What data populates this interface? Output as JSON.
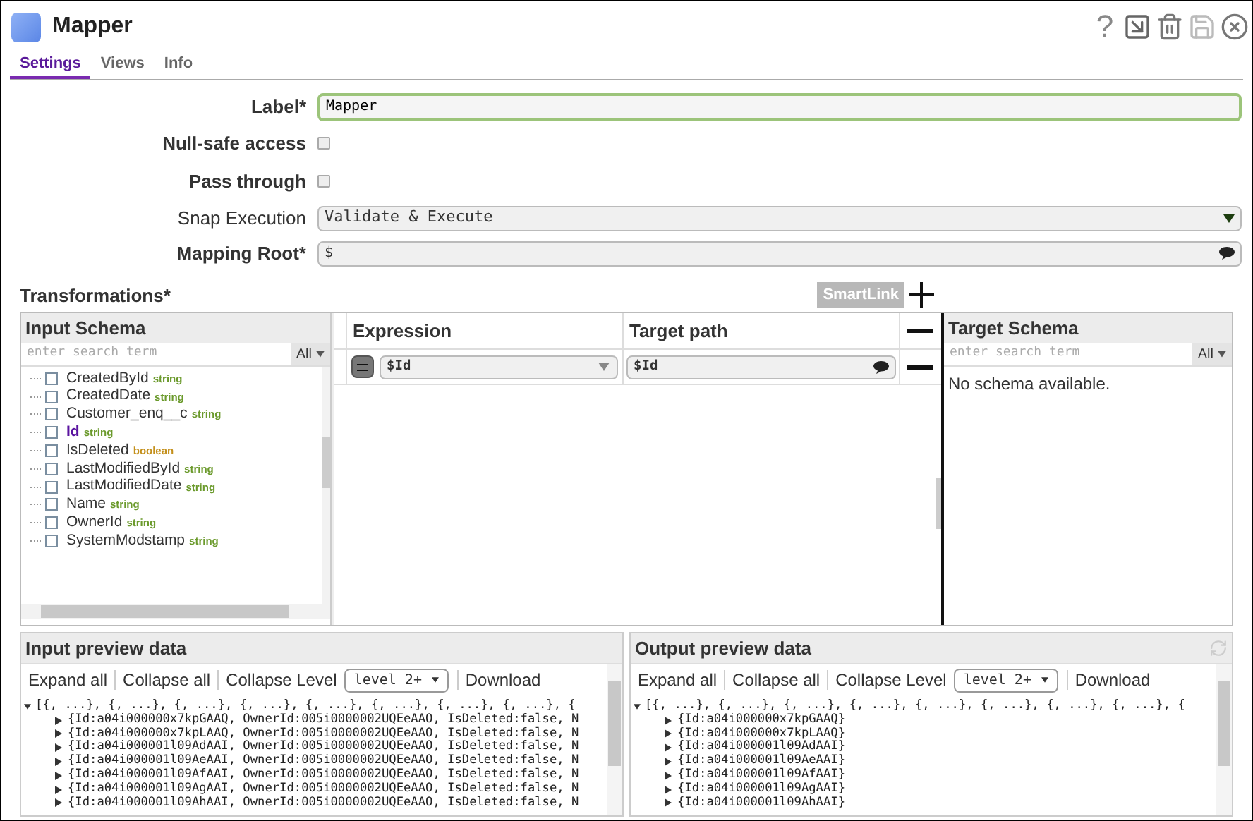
{
  "window": {
    "title": "Mapper",
    "help": "?"
  },
  "tabs": [
    {
      "label": "Settings",
      "selected": true
    },
    {
      "label": "Views",
      "selected": false
    },
    {
      "label": "Info",
      "selected": false
    }
  ],
  "fields": [
    {
      "kind": "text",
      "label": "Label*",
      "value": "Mapper"
    },
    {
      "kind": "checkbox",
      "label": "Null-safe access",
      "checked": false
    },
    {
      "kind": "checkbox",
      "label": "Pass through",
      "checked": false
    },
    {
      "kind": "select",
      "label": "Snap Execution",
      "value": "Validate & Execute"
    },
    {
      "kind": "expression",
      "label": "Mapping Root*",
      "value": "$"
    }
  ],
  "transformations": {
    "title": "Transformations*",
    "smartlink": "SmartLink",
    "input_schema": {
      "title": "Input Schema",
      "placeholder": "enter search term",
      "filter": "All",
      "items": [
        {
          "name": "CreatedById",
          "type": "string",
          "color": "#6b9a2c",
          "selected": false,
          "checked": false
        },
        {
          "name": "CreatedDate",
          "type": "string",
          "color": "#6b9a2c",
          "selected": false,
          "checked": false
        },
        {
          "name": "Customer_enq__c",
          "type": "string",
          "color": "#6b9a2c",
          "selected": false,
          "checked": false
        },
        {
          "name": "Id",
          "type": "string",
          "color": "#6b9a2c",
          "selected": true,
          "checked": false
        },
        {
          "name": "IsDeleted",
          "type": "boolean",
          "color": "#c4901c",
          "selected": false,
          "checked": false
        },
        {
          "name": "LastModifiedById",
          "type": "string",
          "color": "#6b9a2c",
          "selected": false,
          "checked": false
        },
        {
          "name": "LastModifiedDate",
          "type": "string",
          "color": "#6b9a2c",
          "selected": false,
          "checked": false
        },
        {
          "name": "Name",
          "type": "string",
          "color": "#6b9a2c",
          "selected": false,
          "checked": false
        },
        {
          "name": "OwnerId",
          "type": "string",
          "color": "#6b9a2c",
          "selected": false,
          "checked": false
        },
        {
          "name": "SystemModstamp",
          "type": "string",
          "color": "#6b9a2c",
          "selected": false,
          "checked": false
        }
      ]
    },
    "columns": [
      "Expression",
      "Target path"
    ],
    "rows": [
      {
        "expression": "$Id",
        "target_path": "$Id"
      }
    ],
    "target_schema": {
      "title": "Target Schema",
      "placeholder": "enter search term",
      "filter": "All",
      "message": "No schema available."
    }
  },
  "previews": [
    {
      "title": "Input preview data",
      "actions": [
        "Expand all",
        "Collapse all"
      ],
      "collapse_label": "Collapse Level",
      "level": "level 2+",
      "download": "Download",
      "root": "[{, ...}, {, ...}, {, ...}, {, ...}, {, ...}, {, ...}, {, ...}, {, ...}, {",
      "rows": [
        "{Id:a04i000000x7kpGAAQ, OwnerId:005i0000002UQEeAAO, IsDeleted:false, N",
        "{Id:a04i000000x7kpLAAQ, OwnerId:005i0000002UQEeAAO, IsDeleted:false, N",
        "{Id:a04i000001l09AdAAI, OwnerId:005i0000002UQEeAAO, IsDeleted:false, N",
        "{Id:a04i000001l09AeAAI, OwnerId:005i0000002UQEeAAO, IsDeleted:false, N",
        "{Id:a04i000001l09AfAAI, OwnerId:005i0000002UQEeAAO, IsDeleted:false, N",
        "{Id:a04i000001l09AgAAI, OwnerId:005i0000002UQEeAAO, IsDeleted:false, N",
        "{Id:a04i000001l09AhAAI, OwnerId:005i0000002UQEeAAO, IsDeleted:false, N"
      ]
    },
    {
      "title": "Output preview data",
      "actions": [
        "Expand all",
        "Collapse all"
      ],
      "collapse_label": "Collapse Level",
      "level": "level 2+",
      "download": "Download",
      "root": "[{, ...}, {, ...}, {, ...}, {, ...}, {, ...}, {, ...}, {, ...}, {, ...}, {",
      "rows": [
        "{Id:a04i000000x7kpGAAQ}",
        "{Id:a04i000000x7kpLAAQ}",
        "{Id:a04i000001l09AdAAI}",
        "{Id:a04i000001l09AeAAI}",
        "{Id:a04i000001l09AfAAI}",
        "{Id:a04i000001l09AgAAI}",
        "{Id:a04i000001l09AhAAI}"
      ]
    }
  ]
}
